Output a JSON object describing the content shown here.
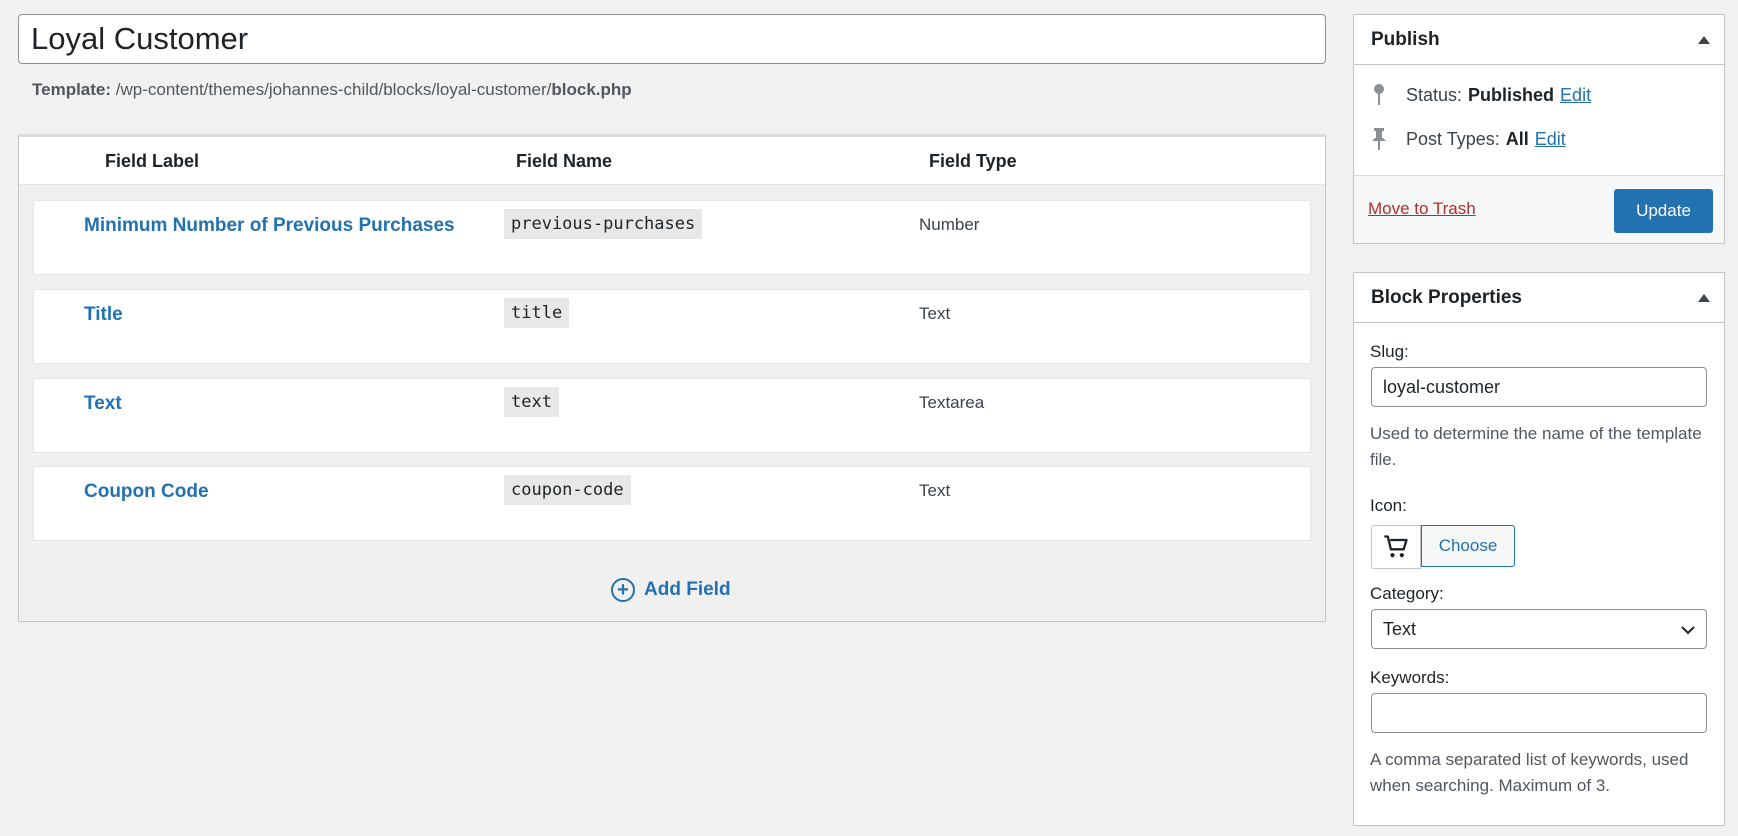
{
  "title_value": "Loyal Customer",
  "template": {
    "label": "Template:",
    "path": "/wp-content/themes/johannes-child/blocks/loyal-customer/",
    "file": "block.php"
  },
  "fields_table": {
    "headers": [
      "Field Label",
      "Field Name",
      "Field Type"
    ],
    "rows": [
      {
        "label": "Minimum Number of Previous Purchases",
        "name": "previous-purchases",
        "type": "Number"
      },
      {
        "label": "Title",
        "name": "title",
        "type": "Text"
      },
      {
        "label": "Text",
        "name": "text",
        "type": "Textarea"
      },
      {
        "label": "Coupon Code",
        "name": "coupon-code",
        "type": "Text"
      }
    ],
    "add_field": "Add Field"
  },
  "publish": {
    "title": "Publish",
    "status_label": "Status:",
    "status_value": "Published",
    "post_types_label": "Post Types:",
    "post_types_value": "All",
    "edit_link": "Edit",
    "trash": "Move to Trash",
    "update": "Update"
  },
  "block_properties": {
    "title": "Block Properties",
    "slug_label": "Slug:",
    "slug_value": "loyal-customer",
    "slug_help": "Used to determine the name of the template file.",
    "icon_label": "Icon:",
    "icon_name": "cart-icon",
    "choose": "Choose",
    "category_label": "Category:",
    "category_value": "Text",
    "keywords_label": "Keywords:",
    "keywords_value": "",
    "keywords_help": "A comma separated list of keywords, used when searching. Maximum of 3."
  },
  "colors": {
    "link": "#2271b1",
    "danger": "#b32d2e",
    "primary_button": "#2271b1"
  }
}
